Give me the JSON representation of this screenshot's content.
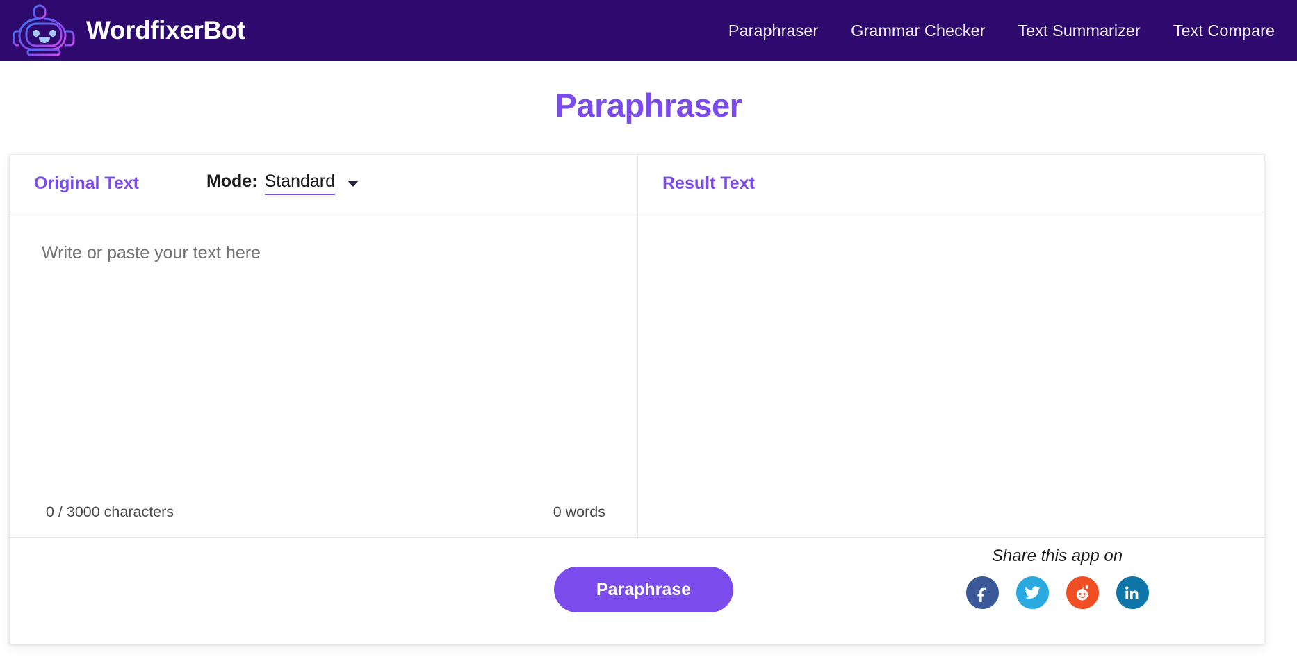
{
  "brand": {
    "name": "WordfixerBot",
    "logo_icon": "robot-head-icon",
    "bar_color": "#2e0a6e"
  },
  "nav": {
    "items": [
      {
        "label": "Paraphraser"
      },
      {
        "label": "Grammar Checker"
      },
      {
        "label": "Text Summarizer"
      },
      {
        "label": "Text Compare"
      }
    ]
  },
  "page": {
    "title": "Paraphraser",
    "title_color": "#7b4ceb"
  },
  "original_panel": {
    "title": "Original Text",
    "mode_label": "Mode:",
    "mode_value": "Standard",
    "mode_caret_icon": "chevron-down-icon",
    "placeholder": "Write or paste your text here",
    "value": "",
    "char_count": "0 / 3000 characters",
    "word_count": "0 words"
  },
  "result_panel": {
    "title": "Result Text",
    "value": ""
  },
  "footer": {
    "paraphrase_label": "Paraphrase",
    "paraphrase_color": "#7b4ceb",
    "share_label": "Share this app on",
    "share_icons": [
      {
        "name": "facebook-icon",
        "color": "#3b5998"
      },
      {
        "name": "twitter-icon",
        "color": "#29a9e0"
      },
      {
        "name": "reddit-icon",
        "color": "#f04e23"
      },
      {
        "name": "linkedin-icon",
        "color": "#0e76a8"
      }
    ]
  }
}
